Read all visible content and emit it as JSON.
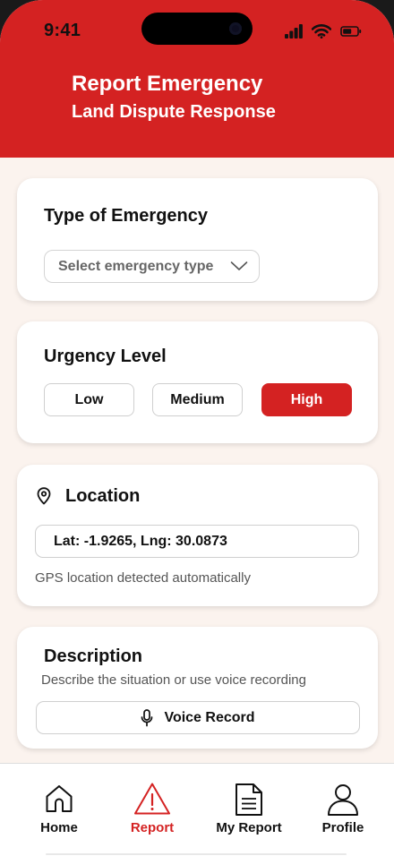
{
  "status_bar": {
    "time": "9:41"
  },
  "header": {
    "title": "Report Emergency",
    "subtitle": "Land Dispute Response"
  },
  "emergency_type": {
    "title": "Type of Emergency",
    "select_placeholder": "Select emergency type"
  },
  "urgency": {
    "title": "Urgency Level",
    "options": [
      "Low",
      "Medium",
      "High"
    ],
    "selected": "High"
  },
  "location": {
    "title": "Location",
    "value": "Lat: -1.9265, Lng: 30.0873",
    "helper": "GPS location detected automatically"
  },
  "description": {
    "title": "Description",
    "helper": "Describe the situation or use voice recording",
    "voice_label": "Voice Record"
  },
  "tabbar": {
    "items": [
      {
        "label": "Home",
        "icon": "home-icon"
      },
      {
        "label": "Report",
        "icon": "warning-icon"
      },
      {
        "label": "My Report",
        "icon": "document-icon"
      },
      {
        "label": "Profile",
        "icon": "user-icon"
      }
    ],
    "active": "Report"
  },
  "colors": {
    "accent": "#d42222",
    "background": "#fbf3ee",
    "card": "#ffffff"
  }
}
